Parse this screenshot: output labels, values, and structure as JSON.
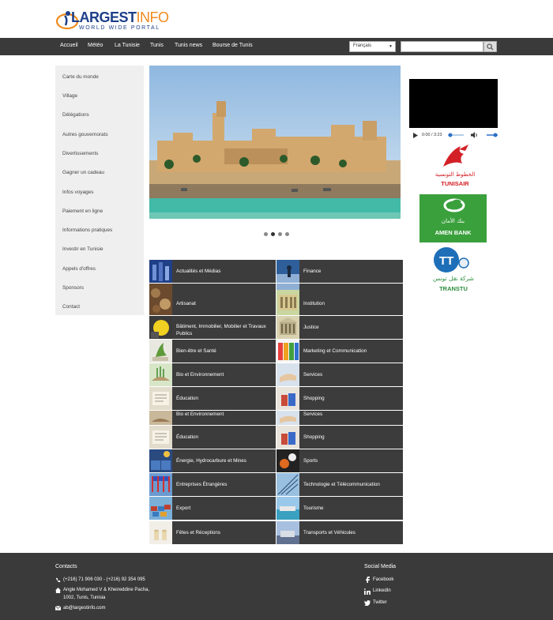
{
  "brand": {
    "name_part1": "LARGEST",
    "name_part2": "INFO",
    "tagline": "WORLD WIDE PORTAL"
  },
  "nav": {
    "items": [
      "Accueil",
      "Météo",
      "La Tunisie",
      "Tunis",
      "Tunis news",
      "Bourse de Tunis"
    ]
  },
  "language_select": {
    "selected": "Français"
  },
  "search": {
    "placeholder": ""
  },
  "sidebar": {
    "items": [
      "Carte du monde",
      "Village",
      "Délégations",
      "Autres gouvernorats",
      "Divertissements",
      "Gagner un cadeau",
      "Infos voyages",
      "Paiement en ligne",
      "Informations pratiques",
      "Investir en Tunisie",
      "Appels d'offres",
      "Sponsors",
      "Contact"
    ]
  },
  "media_player": {
    "time": "0:00 / 3:23"
  },
  "sponsors": {
    "tunisair": {
      "arabic": "الخطوط التونسية",
      "latin": "TUNISAIR"
    },
    "amen_bank": {
      "arabic": "بنك الأمان",
      "latin": "AMEN BANK"
    },
    "transtu": {
      "arabic": "شركة نقل تونس",
      "latin": "TRANSTU"
    }
  },
  "categories": [
    {
      "left": "Actualités et Médias",
      "right": "Finance"
    },
    {
      "left": "Artisanat",
      "right": "Institution"
    },
    {
      "left": "Bâtiment, Immobilier, Mobilier et Travaux Publics",
      "right": "Justice"
    },
    {
      "left": "Bien-être et Santé",
      "right": "Marketing et Communication"
    },
    {
      "left": "Bio et Environnement",
      "right": "Services"
    },
    {
      "left": "Éducation",
      "right": "Shopping"
    },
    {
      "left": "Bio et Environnement",
      "right": "Services"
    },
    {
      "left": "Éducation",
      "right": "Shopping"
    },
    {
      "left": "Énergie, Hydrocarbure et Mines",
      "right": "Sports"
    },
    {
      "left": "Entreprises Étrangères",
      "right": "Technologie et Télécommunication"
    },
    {
      "left": "Export",
      "right": "Tourisme"
    },
    {
      "left": "Fêtes et Réceptions",
      "right": "Transports et Véhicules"
    }
  ],
  "footer": {
    "contacts_title": "Contacts",
    "phone": "(+216) 71 906 030 - (+216) 92 354 095",
    "address_line1": "Angle Mohamed V & Kheireddine Pacha,",
    "address_line2": "1002, Tunis, Tunisia",
    "email": "ab@largestinfo.com",
    "social_title": "Social Media",
    "social": [
      "Facebook",
      "LinkedIn",
      "Twitter"
    ]
  }
}
